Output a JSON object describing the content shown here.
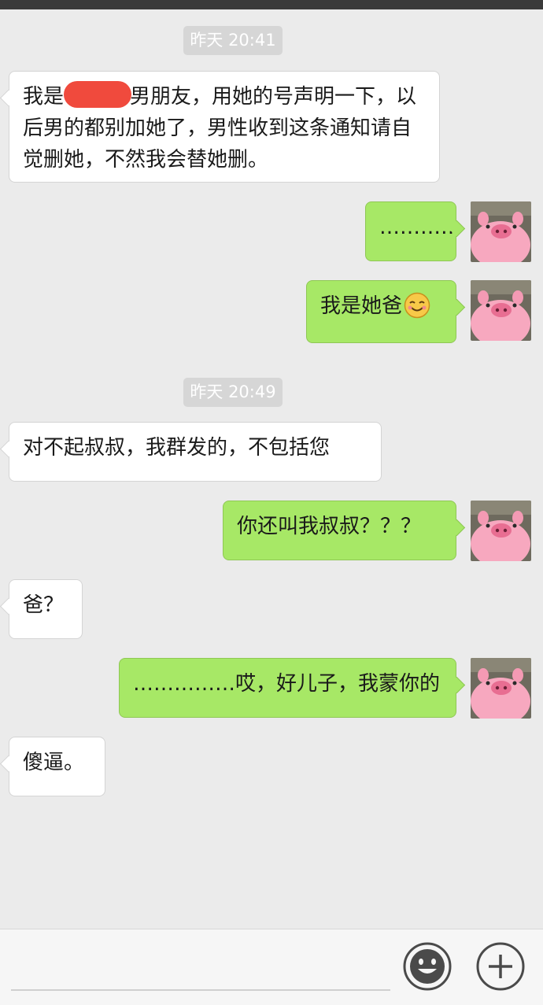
{
  "timestamps": {
    "first": "昨天 20:41",
    "second": "昨天 20:49"
  },
  "messages": {
    "m1_prefix": "我是",
    "m1_rest": "男朋友，用她的号声明一下，以后男的都别加她了，男性收到这条通知请自觉删她，不然我会替她删。",
    "m2": "…………",
    "m3": "我是她爸",
    "m4": "对不起叔叔，我群发的，不包括您",
    "m5": "你还叫我叔叔？？？",
    "m6": "爸？",
    "m7": "……………哎，好儿子，我蒙你的",
    "m8": "傻逼。"
  },
  "icons": {
    "avatar": "pink-pig-avatar",
    "emoji": "smile-emoji",
    "emoji_button": "smiley-face-icon",
    "more_button": "plus-icon"
  },
  "colors": {
    "background": "#ebebeb",
    "outgoing_bubble": "#a7e866",
    "incoming_bubble": "#ffffff",
    "timestamp_pill": "#d6d6d6",
    "redaction": "#f04a3d",
    "avatar_pig": "#f7a8bf"
  }
}
